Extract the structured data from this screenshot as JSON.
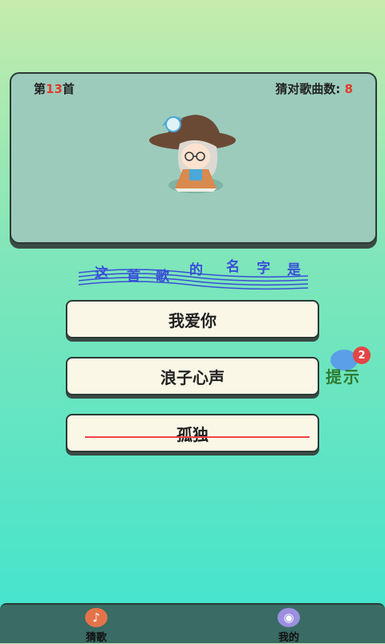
{
  "header": {
    "level_prefix": "第",
    "level_number": "13",
    "level_suffix": "首",
    "score_label": "猜对歌曲数:",
    "score_value": "8"
  },
  "prompt": {
    "chars": [
      "这",
      "首",
      "歌",
      "的",
      "名",
      "字",
      "是"
    ]
  },
  "answers": [
    {
      "label": "我爱你",
      "eliminated": false
    },
    {
      "label": "浪子心声",
      "eliminated": false
    },
    {
      "label": "孤独",
      "eliminated": true
    }
  ],
  "hint": {
    "label": "提示",
    "count": "2"
  },
  "bottom_nav": {
    "guess": {
      "label": "猜歌",
      "icon": "music-note-icon"
    },
    "mine": {
      "label": "我的",
      "icon": "profile-icon"
    }
  },
  "colors": {
    "accent_red": "#e03c2a",
    "prompt_blue": "#3a4fd8",
    "hint_green": "#2f7a30"
  }
}
